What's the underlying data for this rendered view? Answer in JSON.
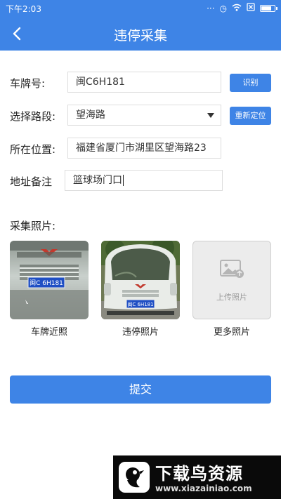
{
  "statusbar": {
    "time": "下午2:03"
  },
  "navbar": {
    "title": "违停采集"
  },
  "form": {
    "plate_label": "车牌号:",
    "plate_value": "闽C6H181",
    "recognize_button": "识别",
    "road_label": "选择路段:",
    "road_value": "望海路",
    "relocate_button": "重新定位",
    "location_label": "所在位置:",
    "location_value": "福建省厦门市湖里区望海路23",
    "remark_label": "地址备注",
    "remark_value": "篮球场门口"
  },
  "photos": {
    "section_label": "采集照片:",
    "items": [
      {
        "caption": "车牌近照",
        "plate_text": "闽C 6H181"
      },
      {
        "caption": "违停照片",
        "plate_text": "闽C 6H181"
      },
      {
        "caption": "更多照片",
        "upload_text": "上传照片"
      }
    ]
  },
  "submit_label": "提交",
  "watermark": {
    "title": "下载鸟资源",
    "url": "www.xiazainiao.com"
  },
  "colors": {
    "primary": "#3e84e6",
    "plate_blue": "#1f4fc4"
  }
}
